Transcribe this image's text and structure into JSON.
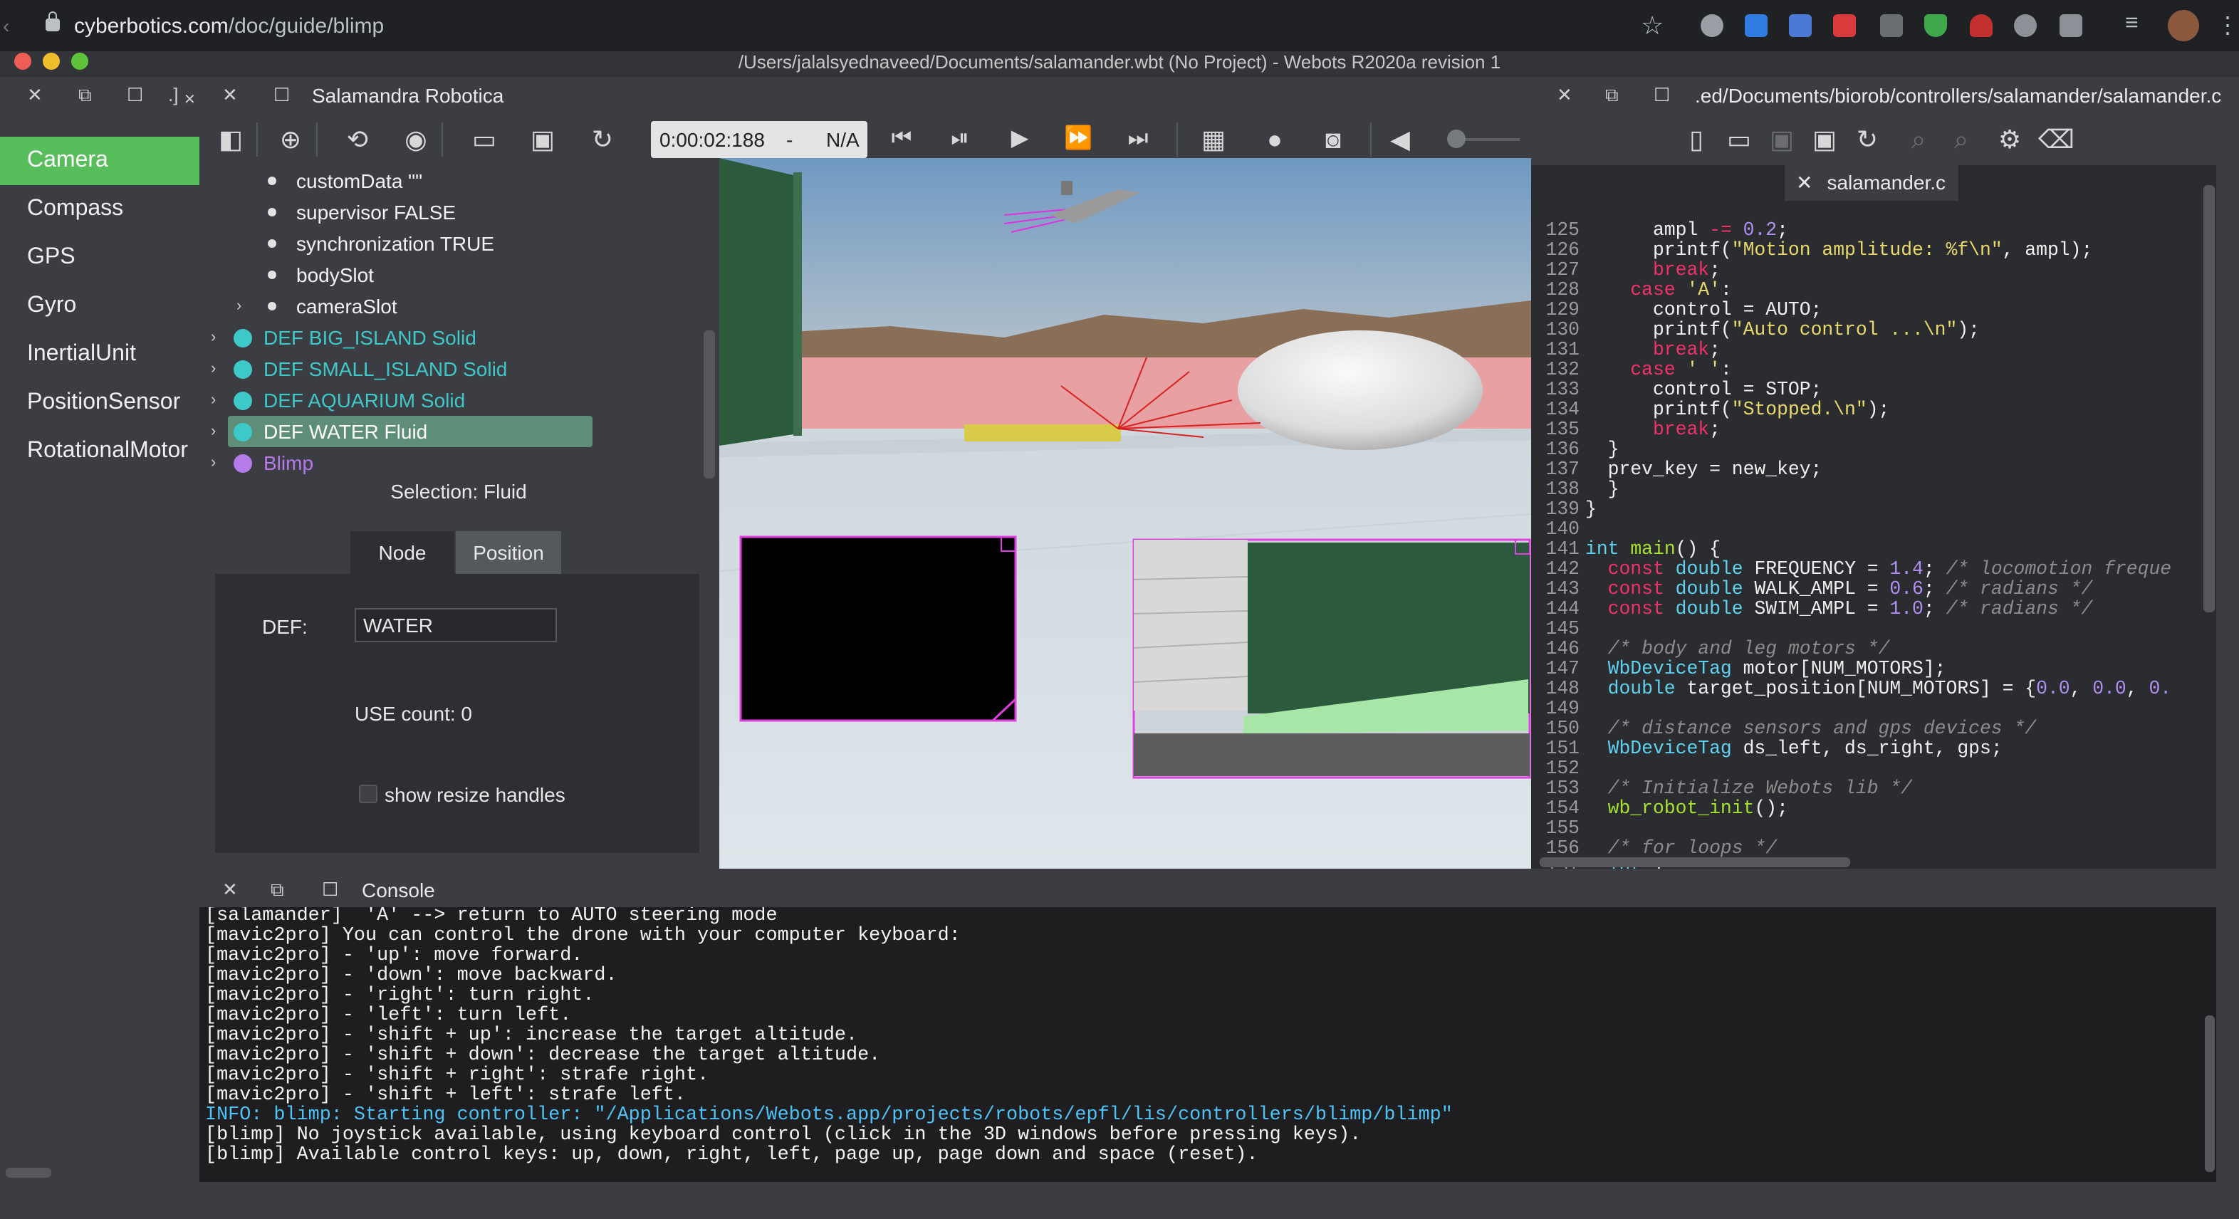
{
  "browser": {
    "url_host": "cyberbotics.com",
    "url_path": "/doc/guide/blimp"
  },
  "window": {
    "title": "/Users/jalalsyednaveed/Documents/salamander.wbt (No Project) - Webots R2020a revision 1"
  },
  "left_panel": {
    "dock_label": ".]",
    "sidebar_items": [
      {
        "label": "Camera",
        "active": true
      },
      {
        "label": "Compass"
      },
      {
        "label": "GPS"
      },
      {
        "label": "Gyro"
      },
      {
        "label": "InertialUnit"
      },
      {
        "label": "PositionSensor"
      },
      {
        "label": "RotationalMotor"
      }
    ]
  },
  "world_panel": {
    "tab_title": "Salamandra Robotica",
    "time": "0:00:02:188",
    "time_sep": "-",
    "speed": "N/A"
  },
  "scene_tree": {
    "fields": [
      "customData \"\"",
      "supervisor FALSE",
      "synchronization TRUE",
      "bodySlot",
      "cameraSlot"
    ],
    "nodes": [
      {
        "label": "DEF BIG_ISLAND Solid",
        "color": "#3ec9c9"
      },
      {
        "label": "DEF SMALL_ISLAND Solid",
        "color": "#3ec9c9"
      },
      {
        "label": "DEF AQUARIUM Solid",
        "color": "#3ec9c9"
      },
      {
        "label": "DEF WATER Fluid",
        "color": "#3ec9c9",
        "selected": true
      },
      {
        "label": "Blimp",
        "color": "#b57bea"
      }
    ]
  },
  "field_editor": {
    "selection": "Selection: Fluid",
    "tab_node": "Node",
    "tab_position": "Position",
    "def_label": "DEF:",
    "def_value": "WATER",
    "use_count": "USE count: 0",
    "resize_label": "show resize handles"
  },
  "editor": {
    "path": ".ed/Documents/biorob/controllers/salamander/salamander.c",
    "file_tab": "salamander.c"
  },
  "console": {
    "title": "Console",
    "lines": [
      {
        "text": "[salamander]  'A' --> return to AUTO steering mode"
      },
      {
        "text": "[mavic2pro] You can control the drone with your computer keyboard:"
      },
      {
        "text": "[mavic2pro] - 'up': move forward."
      },
      {
        "text": "[mavic2pro] - 'down': move backward."
      },
      {
        "text": "[mavic2pro] - 'right': turn right."
      },
      {
        "text": "[mavic2pro] - 'left': turn left."
      },
      {
        "text": "[mavic2pro] - 'shift + up': increase the target altitude."
      },
      {
        "text": "[mavic2pro] - 'shift + down': decrease the target altitude."
      },
      {
        "text": "[mavic2pro] - 'shift + right': strafe right."
      },
      {
        "text": "[mavic2pro] - 'shift + left': strafe left."
      },
      {
        "text": "INFO: blimp: Starting controller: \"/Applications/Webots.app/projects/robots/epfl/lis/controllers/blimp/blimp\"",
        "info": true
      },
      {
        "text": "[blimp] No joystick available, using keyboard control (click in the 3D windows before pressing keys)."
      },
      {
        "text": "[blimp] Available control keys: up, down, right, left, page up, page down and space (reset)."
      }
    ]
  },
  "colors": {
    "accent_green": "#58be5c",
    "selected_row": "#5f8e78",
    "console_bg": "#1e1e20"
  }
}
